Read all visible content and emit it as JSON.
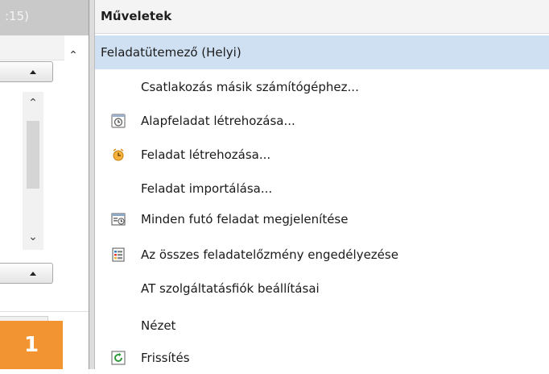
{
  "left_panel": {
    "title_fragment": ":15)",
    "badge": "1"
  },
  "actions_panel": {
    "header": "Műveletek",
    "section": "Feladatütemező (Helyi)",
    "items": [
      {
        "label": "Csatlakozás másik számítógéphez...",
        "icon": null
      },
      {
        "label": "Alapfeladat létrehozása...",
        "icon": "basic-task-icon"
      },
      {
        "label": "Feladat létrehozása...",
        "icon": "create-task-icon"
      },
      {
        "label": "Feladat importálása...",
        "icon": null
      },
      {
        "label": "Minden futó feladat megjelenítése",
        "icon": "running-tasks-icon"
      },
      {
        "label": "Az összes feladatelőzmény engedélyezése",
        "icon": "task-history-icon"
      },
      {
        "label": "AT szolgáltatásfiók beállításai",
        "icon": null
      },
      {
        "label": "Nézet",
        "icon": null
      },
      {
        "label": "Frissítés",
        "icon": "refresh-icon"
      }
    ]
  },
  "colors": {
    "section_highlight": "#cfe0f3",
    "badge": "#f39433"
  }
}
